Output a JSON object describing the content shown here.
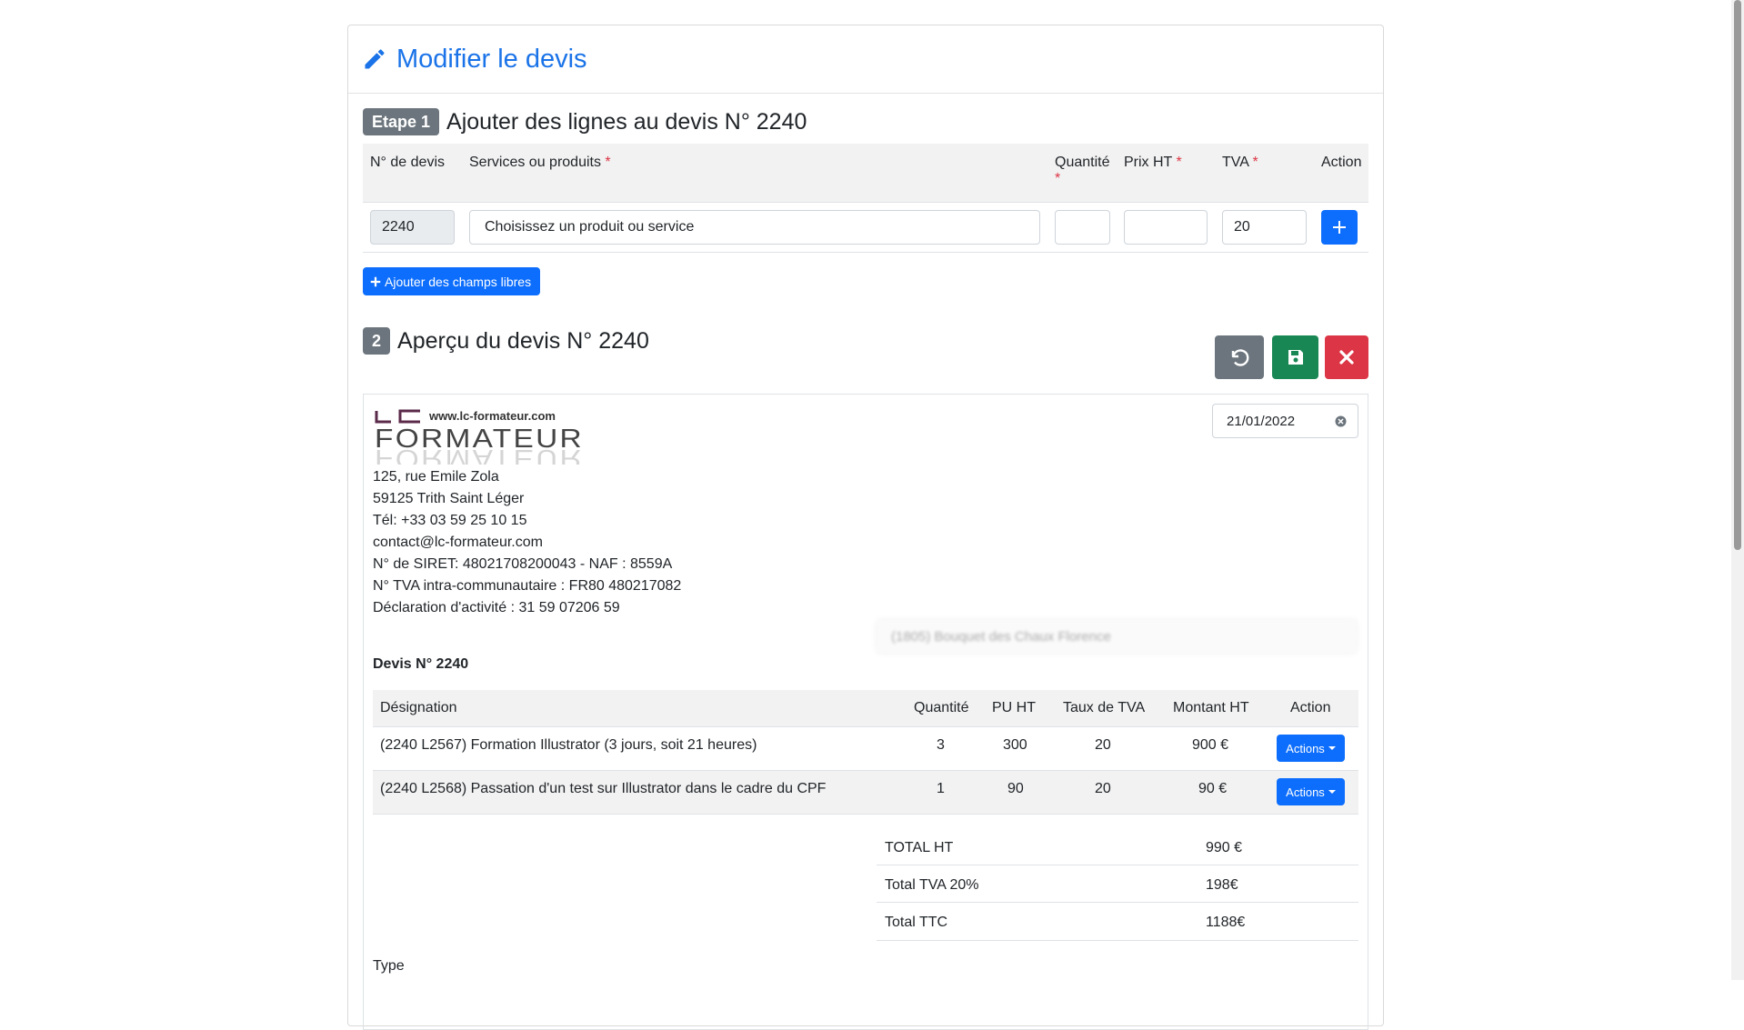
{
  "header": {
    "title": "Modifier le devis",
    "icon": "pencil-icon"
  },
  "step1": {
    "badge": "Etape 1",
    "title": "Ajouter des lignes au devis N° 2240",
    "columns": {
      "numero": "N° de devis",
      "services": "Services ou produits",
      "quantite": "Quantité",
      "prix": "Prix HT",
      "tva": "TVA",
      "action": "Action"
    },
    "required_mark": "*",
    "inputs": {
      "numero_value": "2240",
      "service_placeholder": "Choisissez un produit ou service",
      "quantite_value": "",
      "prix_value": "",
      "tva_value": "20"
    },
    "add_free_fields_label": "Ajouter des champs libres"
  },
  "step2": {
    "badge": "2",
    "title": "Aperçu du devis N° 2240",
    "toolbar": {
      "undo_icon": "undo-icon",
      "save_icon": "floppy-disk-icon",
      "close_icon": "close-icon"
    }
  },
  "company": {
    "logo_url_text": "www.lc-formateur.com",
    "logo_lc": "LC",
    "logo_formateur": "FORMATEUR",
    "address1": "125, rue Emile Zola",
    "address2": "59125 Trith Saint Léger",
    "phone": "Tél: +33 03 59 25 10 15",
    "email": "contact@lc-formateur.com",
    "siret": "N° de SIRET: 48021708200043 - NAF : 8559A",
    "tva_intra": "N° TVA intra-communautaire : FR80 480217082",
    "declaration": "Déclaration d'activité : 31 59 07206 59"
  },
  "date": {
    "day": "21",
    "month": "01",
    "year": "2022"
  },
  "client_field": "(1805) Bouquet des Chaux Florence",
  "devis": {
    "heading": "Devis N° 2240",
    "columns": [
      "Désignation",
      "Quantité",
      "PU HT",
      "Taux de TVA",
      "Montant HT",
      "Action"
    ],
    "rows": [
      {
        "designation": "(2240 L2567) Formation Illustrator (3 jours, soit 21 heures)",
        "quantite": "3",
        "pu": "300",
        "tva": "20",
        "montant": "900 €",
        "action": "Actions"
      },
      {
        "designation": "(2240 L2568) Passation d'un test sur Illustrator dans le cadre du CPF",
        "quantite": "1",
        "pu": "90",
        "tva": "20",
        "montant": "90 €",
        "action": "Actions"
      }
    ],
    "totals": [
      {
        "label": "TOTAL HT",
        "value": "990 €"
      },
      {
        "label": "Total TVA 20%",
        "value": "198€"
      },
      {
        "label": "Total TTC",
        "value": "1188€"
      }
    ],
    "type_label": "Type"
  }
}
